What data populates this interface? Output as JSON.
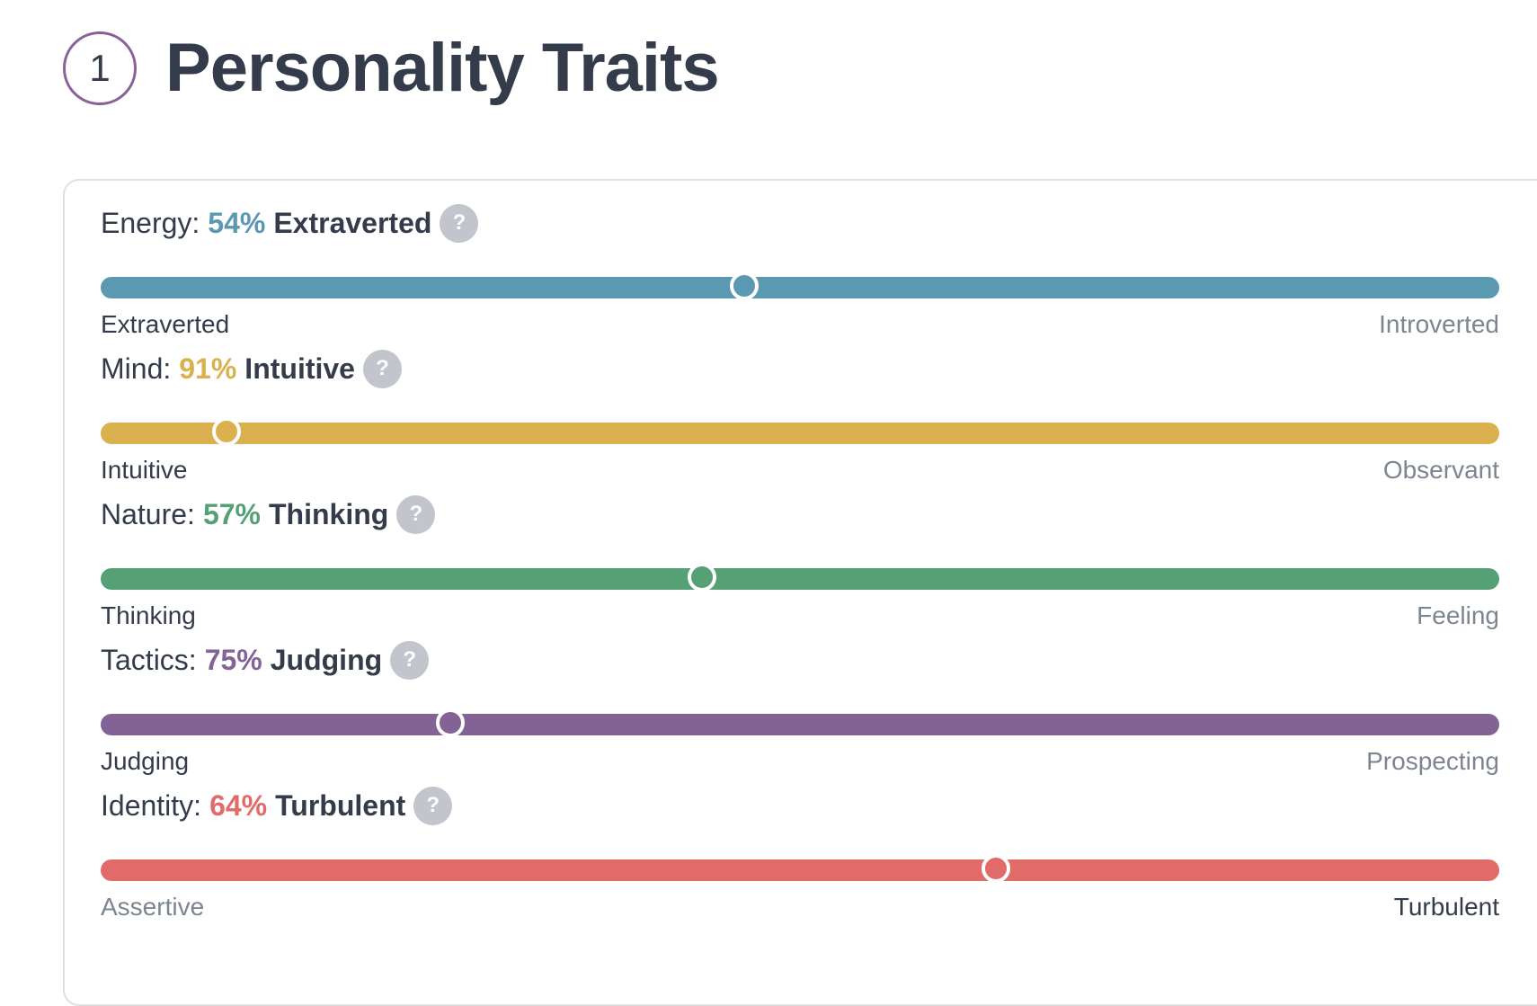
{
  "header": {
    "step_number": "1",
    "title": "Personality Traits"
  },
  "help_icon_glyph": "?",
  "traits": [
    {
      "key": "energy",
      "name": "Energy:",
      "percent_label": "54%",
      "dominant": "Extraverted",
      "left_label": "Extraverted",
      "right_label": "Introverted",
      "active_side": "left",
      "percent": 54,
      "color": "#5b98b2"
    },
    {
      "key": "mind",
      "name": "Mind:",
      "percent_label": "91%",
      "dominant": "Intuitive",
      "left_label": "Intuitive",
      "right_label": "Observant",
      "active_side": "left",
      "percent": 91,
      "color": "#dbb04f"
    },
    {
      "key": "nature",
      "name": "Nature:",
      "percent_label": "57%",
      "dominant": "Thinking",
      "left_label": "Thinking",
      "right_label": "Feeling",
      "active_side": "left",
      "percent": 57,
      "color": "#56a075"
    },
    {
      "key": "tactics",
      "name": "Tactics:",
      "percent_label": "75%",
      "dominant": "Judging",
      "left_label": "Judging",
      "right_label": "Prospecting",
      "active_side": "left",
      "percent": 75,
      "color": "#836396"
    },
    {
      "key": "identity",
      "name": "Identity:",
      "percent_label": "64%",
      "dominant": "Turbulent",
      "left_label": "Assertive",
      "right_label": "Turbulent",
      "active_side": "right",
      "percent": 64,
      "color": "#e06b68"
    }
  ]
}
